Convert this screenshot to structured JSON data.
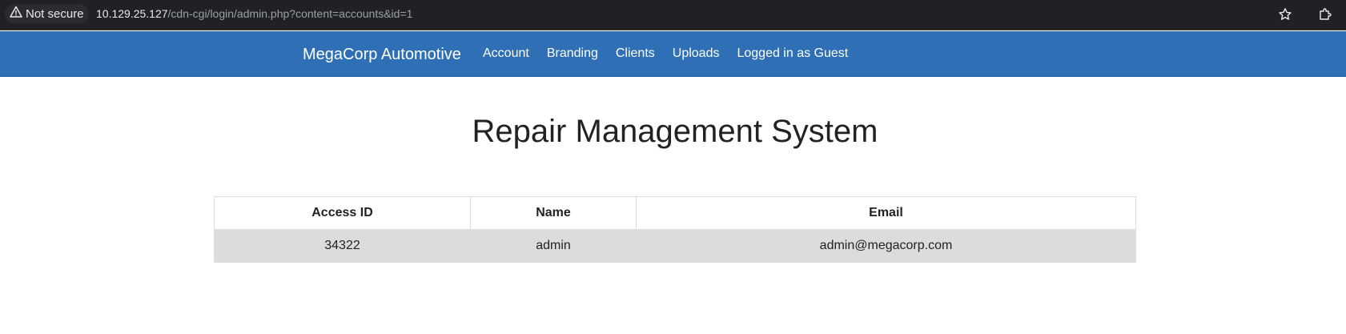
{
  "browser": {
    "security_label": "Not secure",
    "url_host": "10.129.25.127",
    "url_path": "/cdn-cgi/login/admin.php?content=accounts&id=1",
    "icons": [
      "warning-icon",
      "bookmark-star-icon",
      "extensions-icon"
    ]
  },
  "navbar": {
    "brand": "MegaCorp Automotive",
    "links": [
      "Account",
      "Branding",
      "Clients",
      "Uploads",
      "Logged in as Guest"
    ],
    "color": "#2f6fb5"
  },
  "main": {
    "title": "Repair Management System",
    "table": {
      "headers": [
        "Access ID",
        "Name",
        "Email"
      ],
      "rows": [
        [
          "34322",
          "admin",
          "admin@megacorp.com"
        ]
      ]
    }
  }
}
